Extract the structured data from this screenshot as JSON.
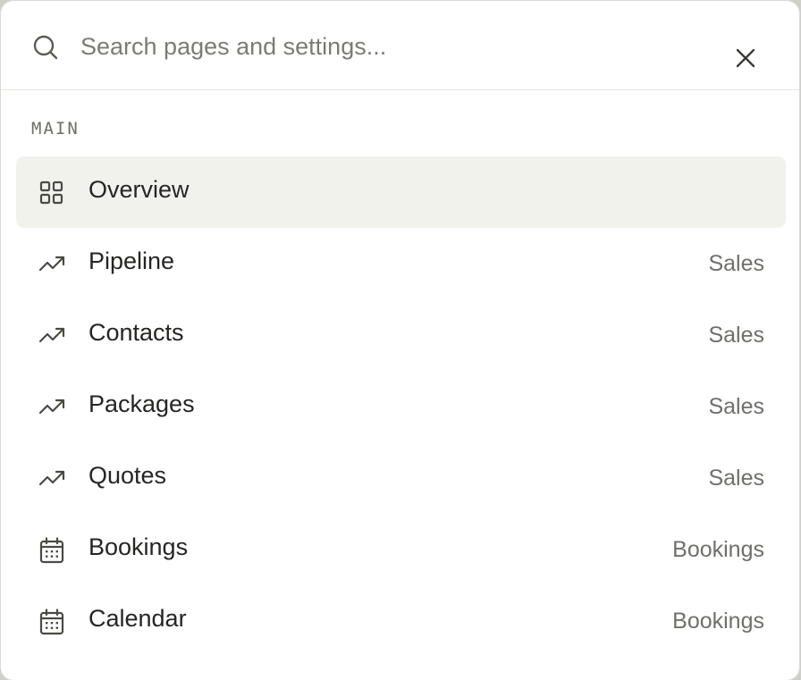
{
  "search": {
    "placeholder": "Search pages and settings..."
  },
  "section": {
    "label": "MAIN"
  },
  "items": [
    {
      "label": "Overview",
      "category": "",
      "icon": "grid-icon",
      "active": true
    },
    {
      "label": "Pipeline",
      "category": "Sales",
      "icon": "trending-up-icon"
    },
    {
      "label": "Contacts",
      "category": "Sales",
      "icon": "trending-up-icon"
    },
    {
      "label": "Packages",
      "category": "Sales",
      "icon": "trending-up-icon"
    },
    {
      "label": "Quotes",
      "category": "Sales",
      "icon": "trending-up-icon"
    },
    {
      "label": "Bookings",
      "category": "Bookings",
      "icon": "calendar-icon"
    },
    {
      "label": "Calendar",
      "category": "Bookings",
      "icon": "calendar-icon"
    }
  ],
  "colors": {
    "active_background": "#f2f2ed",
    "icon": "#4a4a45",
    "text": "#252523",
    "muted_text": "#6f6f6b"
  }
}
